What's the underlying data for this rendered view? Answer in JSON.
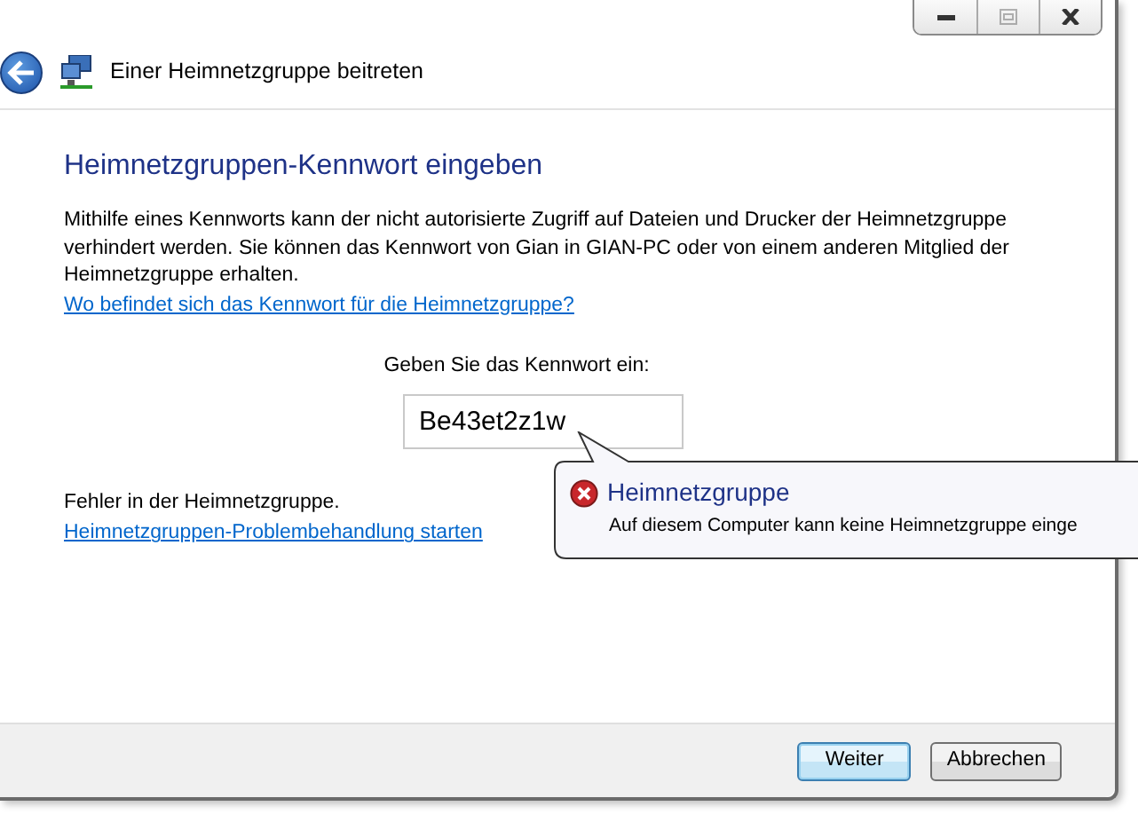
{
  "window": {
    "caption_buttons": [
      {
        "kind": "minimize",
        "disabled": false
      },
      {
        "kind": "maximize",
        "disabled": true
      },
      {
        "kind": "close",
        "disabled": false
      }
    ]
  },
  "header": {
    "title": "Einer Heimnetzgruppe beitreten"
  },
  "heading": "Heimnetzgruppen-Kennwort eingeben",
  "description": "Mithilfe eines Kennworts kann der nicht autorisierte Zugriff auf Dateien und Drucker der Heimnetzgruppe verhindert werden. Sie können das Kennwort von Gian in GIAN-PC oder von einem anderen Mitglied der Heimnetzgruppe erhalten.",
  "help_link": "Wo befindet sich das Kennwort für die Heimnetzgruppe?",
  "password": {
    "label": "Geben Sie das Kennwort ein:",
    "value": "Be43et2z1w"
  },
  "error": {
    "text": "Fehler in der Heimnetzgruppe.",
    "link": "Heimnetzgruppen-Problembehandlung starten"
  },
  "balloon": {
    "title": "Heimnetzgruppe",
    "message": "Auf diesem Computer kann keine Heimnetzgruppe einge"
  },
  "buttons": [
    {
      "label": "Weiter",
      "default": true
    },
    {
      "label": "Abbrechen",
      "default": false
    }
  ]
}
